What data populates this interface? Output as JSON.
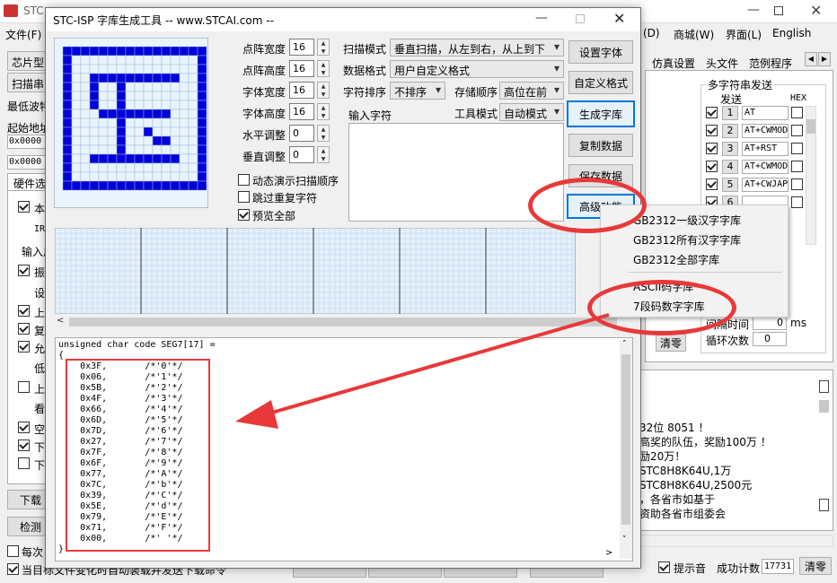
{
  "bg": {
    "title": "STC",
    "menu_file": "文件(F)",
    "menu_right": [
      "(D)",
      "商城(W)",
      "界面(L)",
      "English"
    ],
    "tabs_left": [
      "芯片型",
      "扫描串"
    ],
    "tabs_right": [
      "仿真设置",
      "头文件",
      "范例程序"
    ],
    "min_baud": "最低波特",
    "start_addr": "起始地址",
    "addr1": "0x0000",
    "addr2": "0x0000",
    "hw_tab": "硬件选",
    "left_rows": [
      "本",
      "IRC",
      "输入用",
      "振",
      "设",
      "上",
      "复",
      "允",
      "低",
      "上",
      "看",
      "空",
      "下",
      "下"
    ],
    "download_btn": "下载",
    "detect_btn": "检测",
    "every_time": "每次",
    "auto_reload": "当目标文件变化时自动装载并发送下载命令",
    "serial_send_title": "多字符串发送",
    "send_col": "发送",
    "hex_col": "HEX",
    "serial_rows": [
      {
        "num": "1",
        "text": "AT"
      },
      {
        "num": "2",
        "text": "AT+CWMOD"
      },
      {
        "num": "3",
        "text": "AT+RST"
      },
      {
        "num": "4",
        "text": "AT+CWMOD"
      },
      {
        "num": "5",
        "text": "AT+CWJAP"
      },
      {
        "num": "6",
        "text": ""
      }
    ],
    "interval_label": "间隔时间",
    "interval_value": "0",
    "interval_unit": "ms",
    "loop_label": "循环次数",
    "loop_value": "0",
    "clear_btn": "清零",
    "info_lines": [
      "32位 8051 ！",
      "高奖的队伍，奖励100万 ！",
      "励20万！",
      "STC8H8K64U,1万",
      "STC8H8K64U,2500元",
      "，各省市如基于",
      "资助各省市组委会"
    ],
    "prompt_label": "提示音",
    "success_label": "成功计数",
    "success_value": "17731",
    "clear2_btn": "清零"
  },
  "dlg": {
    "title": "STC-ISP 字库生成工具 -- www.STCAI.com --",
    "dot_width_label": "点阵宽度",
    "dot_width": "16",
    "dot_height_label": "点阵高度",
    "dot_height": "16",
    "font_width_label": "字体宽度",
    "font_width": "16",
    "font_height_label": "字体高度",
    "font_height": "16",
    "h_adjust_label": "水平调整",
    "h_adjust": "0",
    "v_adjust_label": "垂直调整",
    "v_adjust": "0",
    "scan_mode_label": "扫描模式",
    "scan_mode": "垂直扫描，从左到右，从上到下",
    "data_fmt_label": "数据格式",
    "data_fmt": "用户自定义格式",
    "char_sort_label": "字符排序",
    "char_sort": "不排序",
    "store_order_label": "存储顺序",
    "store_order": "高位在前",
    "input_chars_label": "输入字符",
    "tool_mode_label": "工具模式",
    "tool_mode": "自动模式",
    "btn_font": "设置字体",
    "btn_custom": "自定义格式",
    "btn_generate": "生成字库",
    "btn_copy": "复制数据",
    "btn_save": "保存数据",
    "btn_advanced": "高级功能",
    "cb_anim": "动态演示扫描顺序",
    "cb_skip": "跳过重复字符",
    "cb_preview": "预览全部",
    "code_header": "unsigned char code SEG7[17] =",
    "code_brace": "{",
    "code_lines": [
      "    0x3F,       /*'0'*/",
      "    0x06,       /*'1'*/",
      "    0x5B,       /*'2'*/",
      "    0x4F,       /*'3'*/",
      "    0x66,       /*'4'*/",
      "    0x6D,       /*'5'*/",
      "    0x7D,       /*'6'*/",
      "    0x27,       /*'7'*/",
      "    0x7F,       /*'8'*/",
      "    0x6F,       /*'9'*/",
      "    0x77,       /*'A'*/",
      "    0x7C,       /*'b'*/",
      "    0x39,       /*'C'*/",
      "    0x5E,       /*'d'*/",
      "    0x79,       /*'E'*/",
      "    0x71,       /*'F'*/",
      "    0x00,       /*' '*/"
    ],
    "code_end": "}"
  },
  "menu": {
    "items": [
      "GB2312一级汉字字库",
      "GB2312所有汉字字库",
      "GB2312全部字库",
      "ASCII码字库",
      "7段码数字字库"
    ]
  },
  "colors": {
    "grid_fill": "#0000d8",
    "annotation": "#e8393a",
    "focus": "#0078d7"
  }
}
